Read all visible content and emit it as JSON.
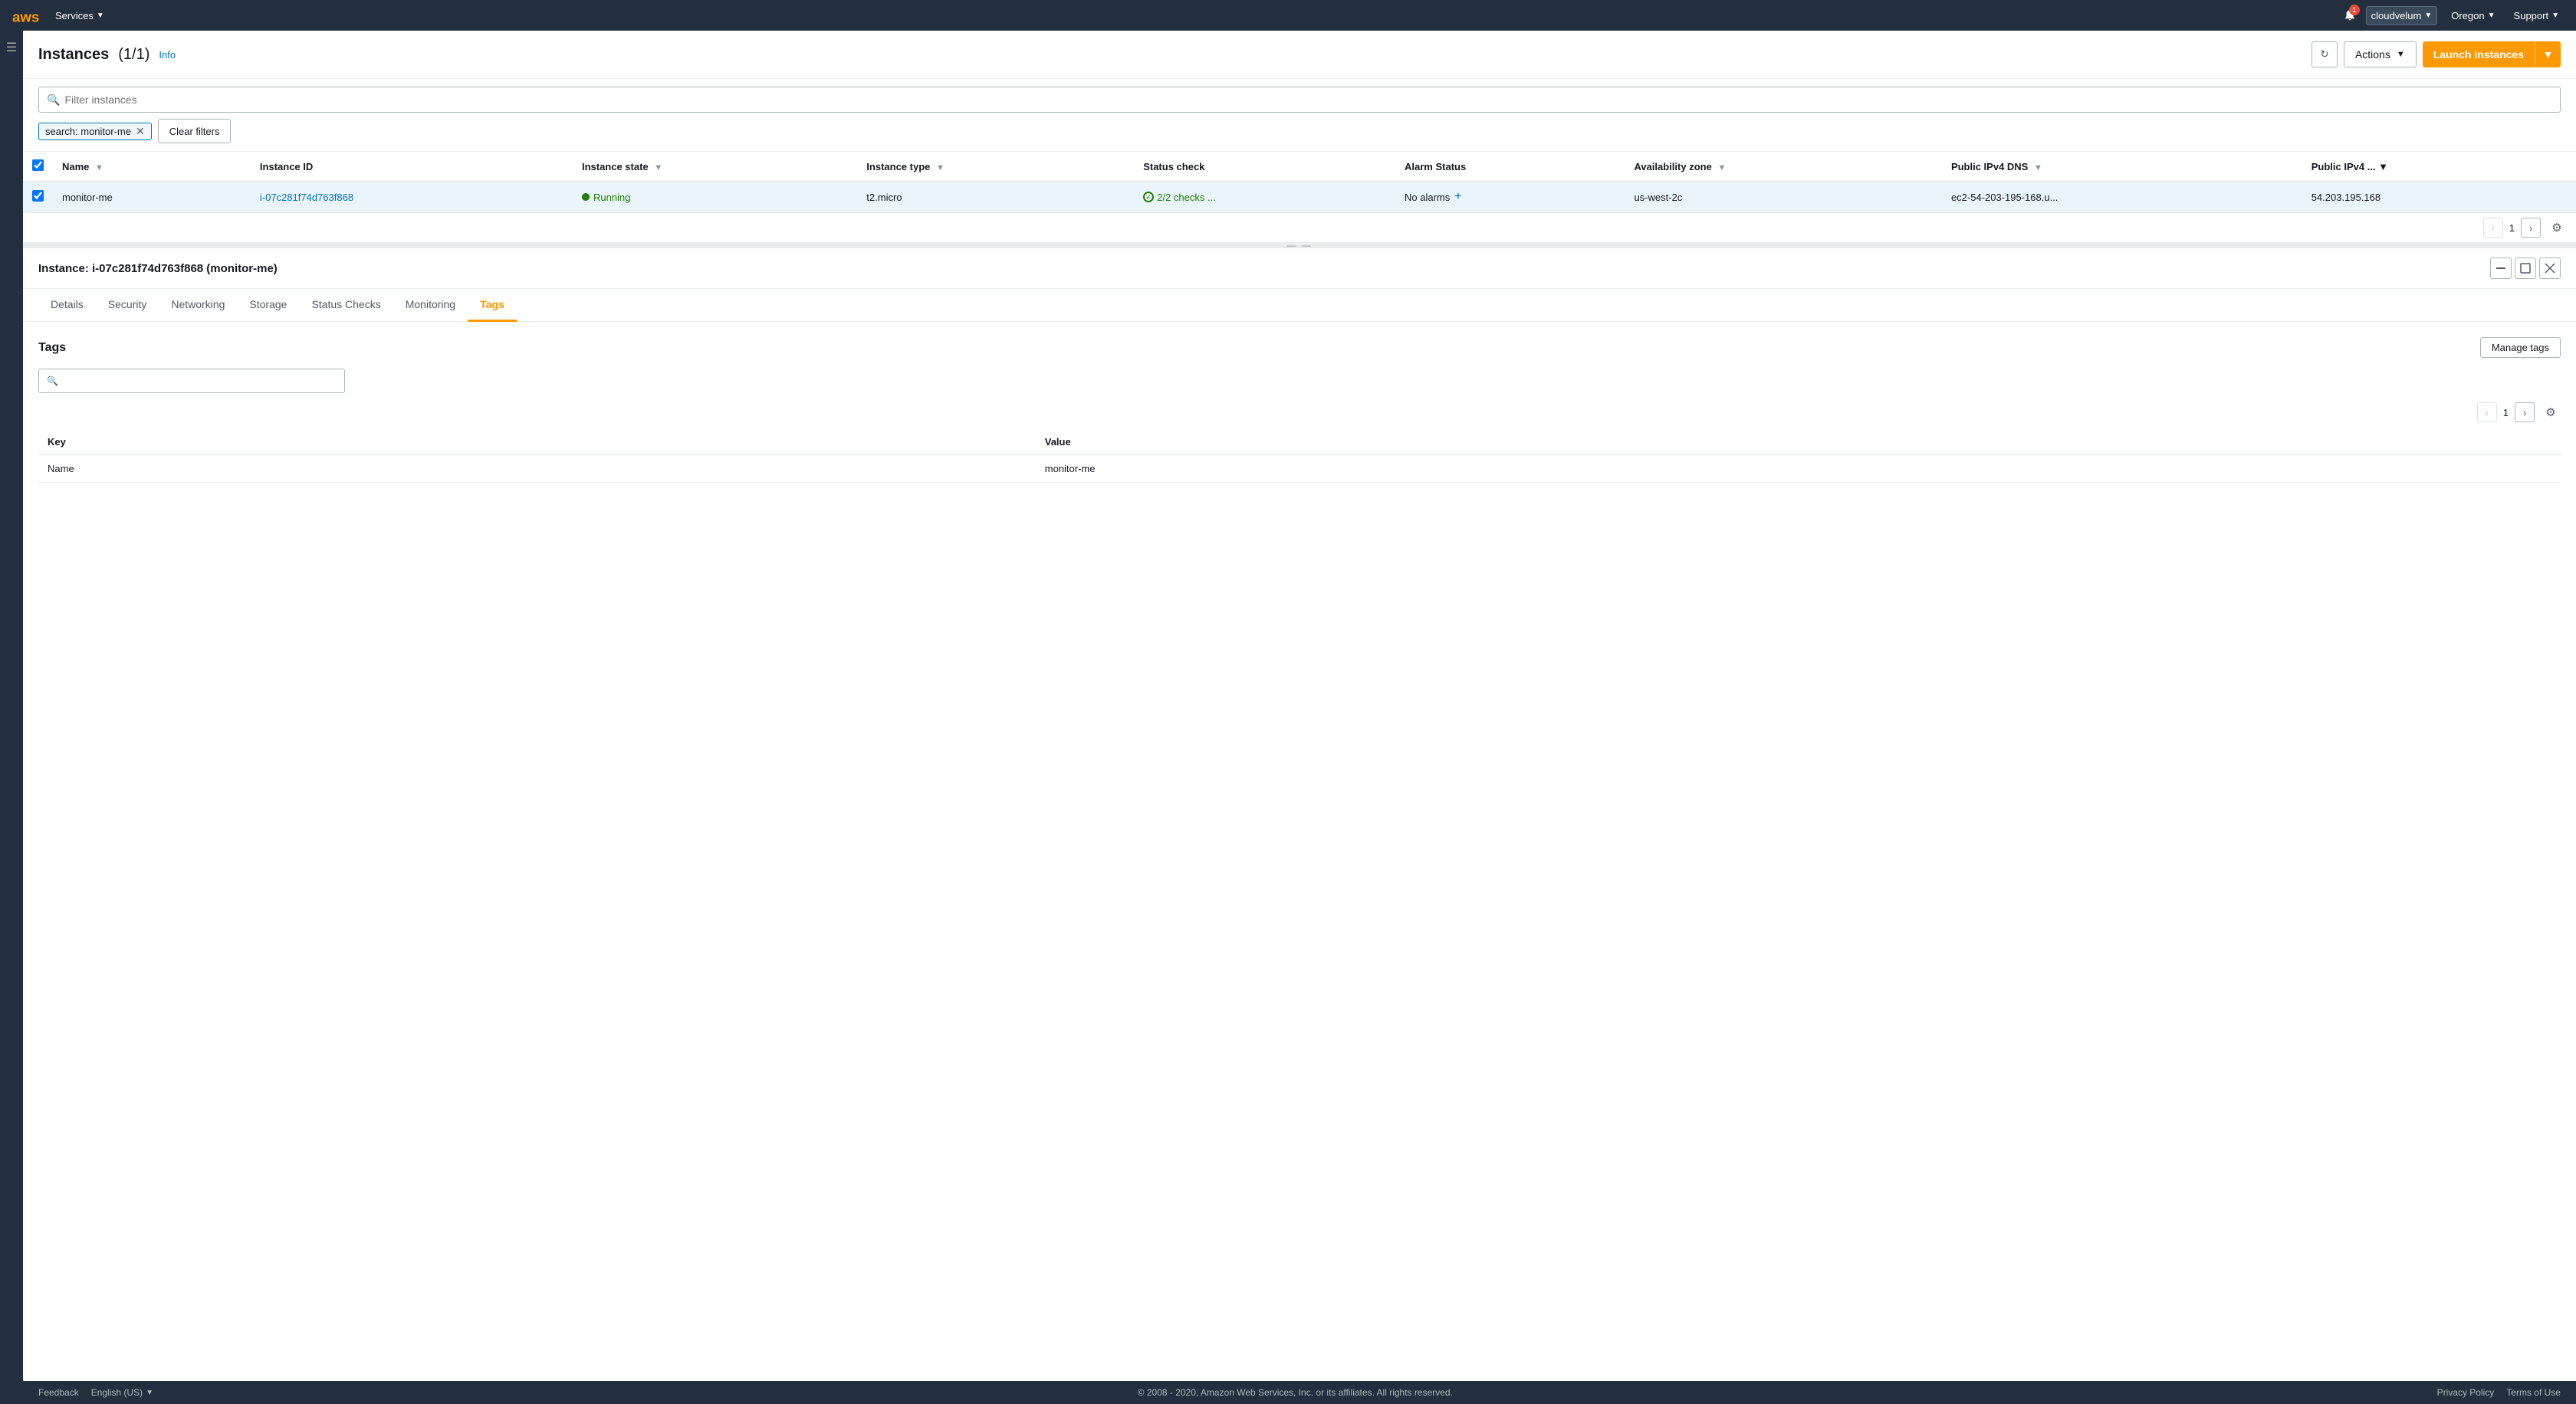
{
  "topnav": {
    "services_label": "Services",
    "account_name": "cloudvelum",
    "region": "Oregon",
    "support": "Support",
    "bell_count": "1"
  },
  "instances_panel": {
    "title": "Instances",
    "count": "(1/1)",
    "info_label": "Info",
    "refresh_icon": "↻",
    "actions_label": "Actions",
    "launch_label": "Launch instances",
    "filter_placeholder": "Filter instances",
    "filter_tag": "search: monitor-me",
    "clear_filters_label": "Clear filters",
    "pagination": {
      "page": "1"
    },
    "table": {
      "columns": [
        "Name",
        "Instance ID",
        "Instance state",
        "Instance type",
        "Status check",
        "Alarm Status",
        "Availability zone",
        "Public IPv4 DNS",
        "Public IPv4 ..."
      ],
      "rows": [
        {
          "name": "monitor-me",
          "instance_id": "i-07c281f74d763f868",
          "state": "Running",
          "type": "t2.micro",
          "status_check": "2/2 checks ...",
          "alarm_status": "No alarms",
          "az": "us-west-2c",
          "dns": "ec2-54-203-195-168.u...",
          "ipv4": "54.203.195.168",
          "selected": true
        }
      ]
    }
  },
  "detail_panel": {
    "instance_title": "Instance: i-07c281f74d763f868 (monitor-me)",
    "tabs": [
      {
        "label": "Details",
        "id": "details",
        "active": false
      },
      {
        "label": "Security",
        "id": "security",
        "active": false
      },
      {
        "label": "Networking",
        "id": "networking",
        "active": false
      },
      {
        "label": "Storage",
        "id": "storage",
        "active": false
      },
      {
        "label": "Status Checks",
        "id": "status-checks",
        "active": false
      },
      {
        "label": "Monitoring",
        "id": "monitoring",
        "active": false
      },
      {
        "label": "Tags",
        "id": "tags",
        "active": true
      }
    ],
    "tags": {
      "section_title": "Tags",
      "manage_tags_label": "Manage tags",
      "search_placeholder": "",
      "pagination": {
        "page": "1"
      },
      "columns": [
        "Key",
        "Value"
      ],
      "rows": [
        {
          "key": "Name",
          "value": "monitor-me"
        }
      ]
    }
  },
  "footer": {
    "feedback": "Feedback",
    "language": "English (US)",
    "copyright": "© 2008 - 2020, Amazon Web Services, Inc. or its affiliates. All rights reserved.",
    "privacy_policy": "Privacy Policy",
    "terms": "Terms of Use"
  },
  "icons": {
    "search": "🔍",
    "chevron_down": "▼",
    "close": "✕",
    "refresh": "↻",
    "gear": "⚙",
    "chevron_left": "‹",
    "chevron_right": "›",
    "plus": "+",
    "minimize": "▬",
    "expand": "⬜",
    "close_panel": "✕"
  }
}
